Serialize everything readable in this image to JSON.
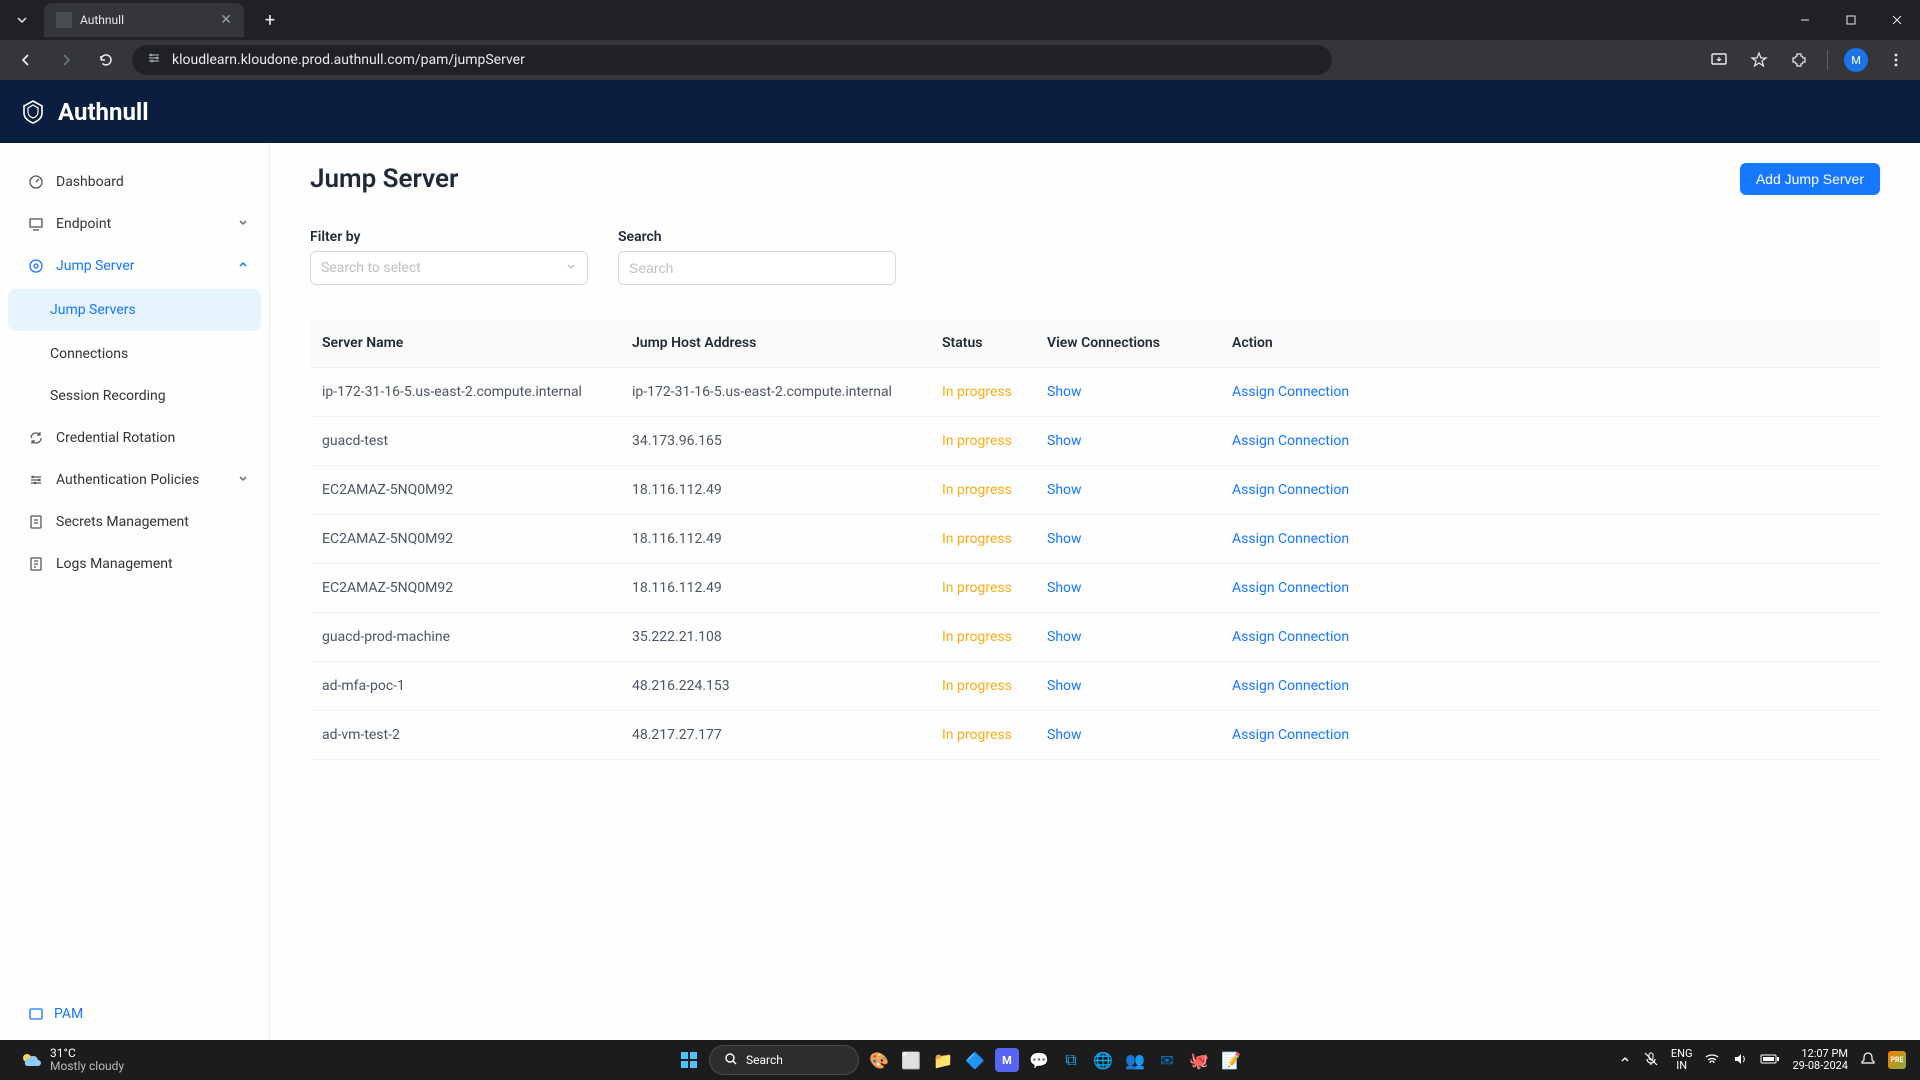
{
  "browser": {
    "tab_title": "Authnull",
    "url": "kloudlearn.kloudone.prod.authnull.com/pam/jumpServer",
    "avatar_initial": "M"
  },
  "app": {
    "name": "Authnull"
  },
  "sidebar": {
    "items": [
      {
        "label": "Dashboard"
      },
      {
        "label": "Endpoint"
      },
      {
        "label": "Jump Server"
      },
      {
        "label": "Credential Rotation"
      },
      {
        "label": "Authentication Policies"
      },
      {
        "label": "Secrets Management"
      },
      {
        "label": "Logs Management"
      }
    ],
    "jump_submenu": [
      {
        "label": "Jump Servers"
      },
      {
        "label": "Connections"
      },
      {
        "label": "Session Recording"
      }
    ],
    "footer_label": "PAM"
  },
  "page": {
    "title": "Jump Server",
    "add_button": "Add Jump Server",
    "filter_label": "Filter by",
    "filter_placeholder": "Search to select",
    "search_label": "Search",
    "search_placeholder": "Search"
  },
  "table": {
    "headers": [
      "Server Name",
      "Jump Host Address",
      "Status",
      "View Connections",
      "Action"
    ],
    "status_text": "In progress",
    "show_text": "Show",
    "assign_text": "Assign Connection",
    "rows": [
      {
        "name": "ip-172-31-16-5.us-east-2.compute.internal",
        "addr": "ip-172-31-16-5.us-east-2.compute.internal"
      },
      {
        "name": "guacd-test",
        "addr": "34.173.96.165"
      },
      {
        "name": "EC2AMAZ-5NQ0M92",
        "addr": "18.116.112.49"
      },
      {
        "name": "EC2AMAZ-5NQ0M92",
        "addr": "18.116.112.49"
      },
      {
        "name": "EC2AMAZ-5NQ0M92",
        "addr": "18.116.112.49"
      },
      {
        "name": "guacd-prod-machine",
        "addr": "35.222.21.108"
      },
      {
        "name": "ad-mfa-poc-1",
        "addr": "48.216.224.153"
      },
      {
        "name": "ad-vm-test-2",
        "addr": "48.217.27.177"
      }
    ]
  },
  "taskbar": {
    "temp": "31°C",
    "weather": "Mostly cloudy",
    "search": "Search",
    "lang1": "ENG",
    "lang2": "IN",
    "time": "12:07 PM",
    "date": "29-08-2024"
  }
}
